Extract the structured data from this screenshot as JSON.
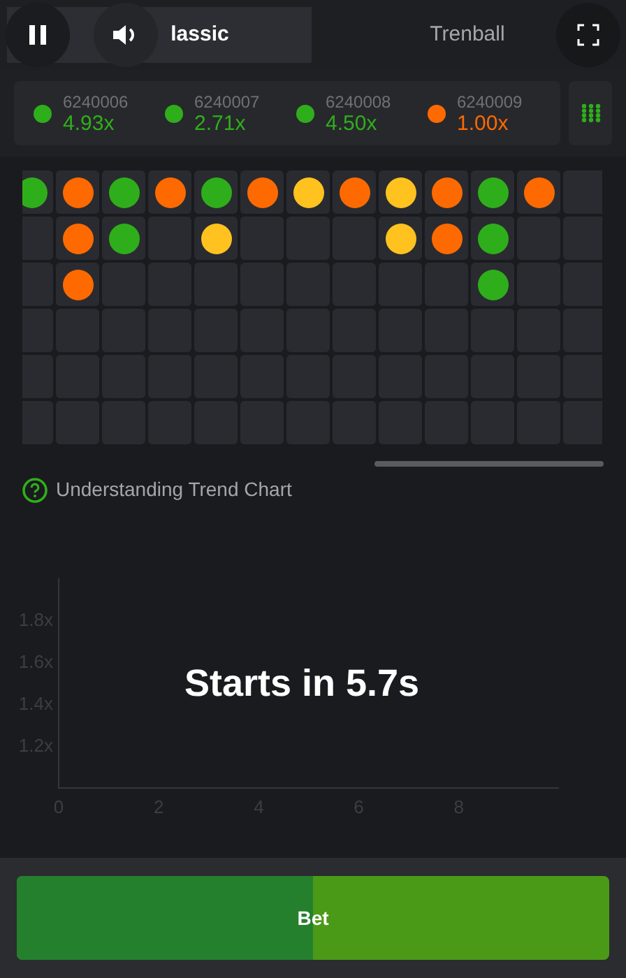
{
  "top_bar": {
    "tabs": [
      {
        "label": "lassic",
        "selected": true
      },
      {
        "label": "Trenball",
        "selected": false
      }
    ]
  },
  "recent_rounds": [
    {
      "round": "6240006",
      "multiplier": "4.93x",
      "color": "#2fae1b"
    },
    {
      "round": "6240007",
      "multiplier": "2.71x",
      "color": "#2fae1b"
    },
    {
      "round": "6240008",
      "multiplier": "4.50x",
      "color": "#2fae1b"
    },
    {
      "round": "6240009",
      "multiplier": "1.00x",
      "color": "#ff6a00"
    }
  ],
  "trend_grid": {
    "columns": [
      {
        "dots": [
          {
            "color": "#2fae1b"
          }
        ]
      },
      {
        "dots": [
          {
            "color": "#ff6a00"
          },
          {
            "color": "#ff6a00"
          },
          {
            "color": "#ff6a00"
          }
        ]
      },
      {
        "dots": [
          {
            "color": "#2fae1b"
          },
          {
            "color": "#2fae1b"
          }
        ]
      },
      {
        "dots": [
          {
            "color": "#ff6a00"
          }
        ]
      },
      {
        "dots": [
          {
            "color": "#2fae1b"
          },
          {
            "color": "#ffc21f"
          }
        ]
      },
      {
        "dots": [
          {
            "color": "#ff6a00"
          }
        ]
      },
      {
        "dots": [
          {
            "color": "#ffc21f"
          }
        ]
      },
      {
        "dots": [
          {
            "color": "#ff6a00"
          }
        ]
      },
      {
        "dots": [
          {
            "color": "#ffc21f"
          },
          {
            "color": "#ffc21f"
          }
        ]
      },
      {
        "dots": [
          {
            "color": "#ff6a00"
          },
          {
            "color": "#ff6a00"
          }
        ]
      },
      {
        "dots": [
          {
            "color": "#2fae1b"
          },
          {
            "color": "#2fae1b"
          },
          {
            "color": "#2fae1b"
          }
        ]
      },
      {
        "dots": [
          {
            "color": "#ff6a00"
          }
        ]
      }
    ]
  },
  "help_link": "Understanding Trend Chart",
  "game": {
    "countdown": "Starts in 5.7s",
    "chart_data": {
      "type": "line",
      "xlim": [
        0,
        10
      ],
      "ylim": [
        1,
        2
      ],
      "xticks": [
        0,
        2,
        4,
        6,
        8
      ],
      "yticks": [
        {
          "value": 1.2,
          "label": "1.2x"
        },
        {
          "value": 1.4,
          "label": "1.4x"
        },
        {
          "value": 1.6,
          "label": "1.6x"
        },
        {
          "value": 1.8,
          "label": "1.8x"
        }
      ]
    }
  },
  "bet_button": {
    "label": "Bet",
    "level": 0.5
  }
}
